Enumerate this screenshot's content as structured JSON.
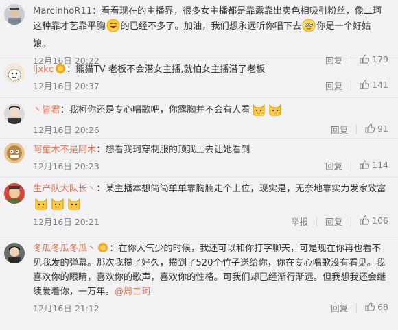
{
  "comments": [
    {
      "username": "MarcinhoR11",
      "username_color": "#555555",
      "separator": "：",
      "text_parts": [
        "看看现在的主播界，很多女主播都是靠露靠出卖色相吸引粉丝，像二珂这种靠才艺靠平胸",
        "的已经不多了。加油，我们想永远听你唱下去",
        "你是一个好姑娘。"
      ],
      "time": "12月16日 20:22",
      "reply_label": "回复",
      "likes": "179"
    },
    {
      "username": "ljxkc",
      "separator": "：",
      "text": "熊猫TV 老板不会潜女主播,就怕女主播潜了老板",
      "time": "12月16日 20:37",
      "reply_label": "回复",
      "likes": "141"
    },
    {
      "username": "丶皆君",
      "separator": "：",
      "text": "我柯你还是专心唱歌吧，你露胸并不会有人看",
      "time": "12月16日 20:26",
      "reply_label": "回复",
      "likes": "91"
    },
    {
      "username": "阿童木不是阿木",
      "separator": "：",
      "text": "想看我珂穿制服的顶我上去让她看到",
      "time": "12月16日 20:23",
      "reply_label": "回复",
      "likes": "114"
    },
    {
      "username": "生产队大队长丶",
      "separator": "：",
      "text": "某主播本想简简单单靠胸腩走个上位，现实是，无奈地靠实力发家致富",
      "time": "12月16日 20:21",
      "report_label": "举报",
      "reply_label": "回复",
      "likes": "106"
    },
    {
      "username": "冬瓜冬瓜冬瓜丶",
      "separator": "：",
      "text": "在你人气少的时候，我还可以和你打字聊天，可是现在你再也看不见我发的弹幕。那次我攒了好久，攒到了520个竹子送给你，你在专心唱歌没有看见。我喜欢你的眼睛，喜欢你的歌声，喜欢你的性格。可我们却已经渐行渐远。但我想我还会继续爱着你，一万年。",
      "mention": "@周二珂",
      "time": "12月16日 21:12",
      "reply_label": "回复",
      "likes": "68"
    }
  ],
  "colors": {
    "username": "#eb7350",
    "text": "#333333",
    "meta": "#808080",
    "background": "#f2f2f5"
  },
  "icons": [
    "thumb-up-icon",
    "vip-badge-icon",
    "laugh-emoji-icon",
    "doge-emoji-icon",
    "cat-emoji-icon"
  ]
}
